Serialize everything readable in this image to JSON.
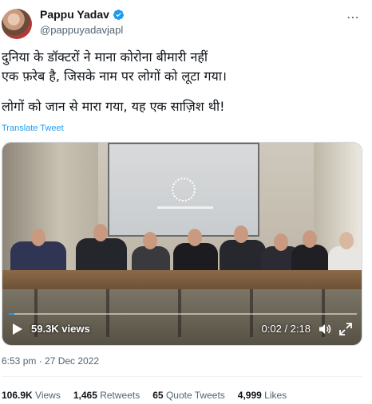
{
  "user": {
    "display_name": "Pappu Yadav",
    "handle": "@pappuyadavjapl",
    "verified_icon": "verified-badge-icon",
    "verified_color": "#1d9bf0"
  },
  "tweet": {
    "paragraph_1": "दुनिया के डॉक्टरों ने माना कोरोना बीमारी नहीं\nएक फ़रेब है, जिसके नाम पर लोगों को लूटा गया।",
    "paragraph_2": "लोगों को जान से मारा गया, यह एक साज़िश थी!",
    "translate_label": "Translate Tweet"
  },
  "video": {
    "views": "59.3K views",
    "time": "0:02 / 2:18",
    "progress": 0.015
  },
  "meta": {
    "timestamp": "6:53 pm · 27 Dec 2022"
  },
  "stats": [
    {
      "value": "106.9K",
      "label": "Views"
    },
    {
      "value": "1,465",
      "label": "Retweets"
    },
    {
      "value": "65",
      "label": "Quote Tweets"
    },
    {
      "value": "4,999",
      "label": "Likes"
    }
  ],
  "colors": {
    "accent": "#1d9bf0",
    "text": "#0f1419",
    "secondary": "#536471"
  }
}
